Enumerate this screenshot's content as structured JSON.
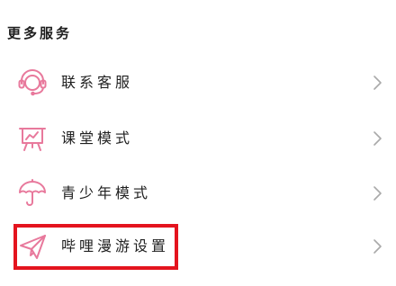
{
  "section": {
    "title": "更多服务"
  },
  "items": [
    {
      "label": "联系客服",
      "icon": "headset-icon"
    },
    {
      "label": "课堂模式",
      "icon": "presentation-board-icon"
    },
    {
      "label": "青少年模式",
      "icon": "umbrella-icon"
    },
    {
      "label": "哔哩漫游设置",
      "icon": "paper-plane-icon"
    }
  ],
  "colors": {
    "icon_pink": "#e8799c",
    "chevron_gray": "#a9a9a9",
    "highlight_red": "#e4141e"
  }
}
